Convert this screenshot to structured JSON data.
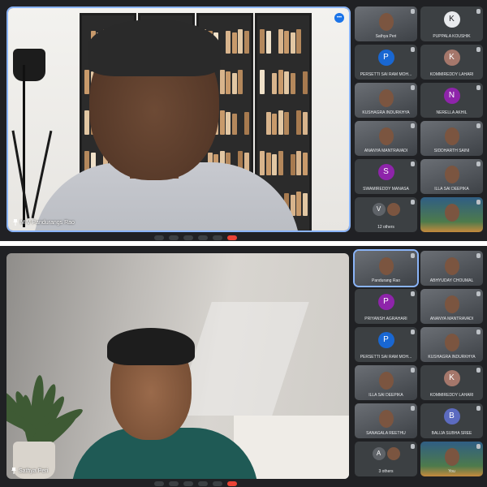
{
  "colors": {
    "background": "#202124",
    "tile": "#3c4043",
    "accent": "#8ab4f8",
    "end_call": "#ea4335"
  },
  "top_meeting": {
    "main_speaker": "M V Pandurangs Rao",
    "main_more_label": "•••",
    "participants": [
      {
        "name": "Sathya Peri",
        "type": "video"
      },
      {
        "name": "PUPPALA KOUSHIK",
        "initial": "K",
        "color": "#e8eaed",
        "text_color": "#202124"
      },
      {
        "name": "PERSETTI SAI RAM MOH...",
        "initial": "P",
        "color": "#1967d2"
      },
      {
        "name": "KOMMIREDDY LAHARI",
        "initial": "K",
        "color": "#a5776b"
      },
      {
        "name": "KUSHAGRA INDURKHYA",
        "type": "video"
      },
      {
        "name": "NERELLA AKHIL",
        "initial": "N",
        "color": "#8e24aa"
      },
      {
        "name": "ANANYA MANTRAVADI",
        "type": "video"
      },
      {
        "name": "SIDDHARTH SAINI",
        "type": "video"
      },
      {
        "name": "SWAMIREDDY MANASA",
        "initial": "S",
        "color": "#8e24aa"
      },
      {
        "name": "ILLA SAI DEEPIKA",
        "type": "video"
      },
      {
        "name": "12 others",
        "type": "others",
        "initials": [
          "V"
        ]
      },
      {
        "name": "",
        "type": "scenery"
      }
    ]
  },
  "bottom_meeting": {
    "main_speaker": "Sathya Peri",
    "participants": [
      {
        "name": "Pandurang Rao",
        "type": "video",
        "highlight": true
      },
      {
        "name": "ABHYUDAY CHOUMAL",
        "type": "video"
      },
      {
        "name": "PRIYANSH AGRAHARI",
        "initial": "P",
        "color": "#8e24aa"
      },
      {
        "name": "ANANYA MANTRAVADI",
        "type": "video"
      },
      {
        "name": "PERSETTI SAI RAM MOH...",
        "initial": "P",
        "color": "#1967d2"
      },
      {
        "name": "KUSHAGRA INDURKHYA",
        "type": "video"
      },
      {
        "name": "ILLA SAI DEEPIKA",
        "type": "video"
      },
      {
        "name": "KOMMIREDDY LAHARI",
        "initial": "K",
        "color": "#a5776b"
      },
      {
        "name": "SANAGALA REETHU",
        "type": "video"
      },
      {
        "name": "BALIJA SUBHA SREE",
        "initial": "B",
        "color": "#5c6bc0"
      },
      {
        "name": "3 others",
        "type": "others",
        "initials": [
          "A"
        ]
      },
      {
        "name": "You",
        "type": "scenery"
      }
    ]
  }
}
